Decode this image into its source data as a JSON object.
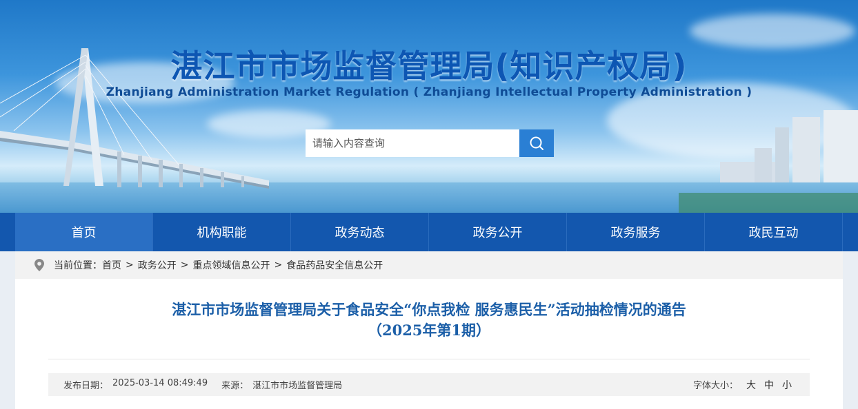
{
  "header": {
    "title": "湛江市市场监督管理局(知识产权局)",
    "subtitle": "Zhanjiang Administration Market Regulation ( Zhanjiang Intellectual Property Administration )"
  },
  "search": {
    "placeholder": "请输入内容查询",
    "icon": "search-icon"
  },
  "nav": {
    "items": [
      {
        "label": "首页"
      },
      {
        "label": "机构职能"
      },
      {
        "label": "政务动态"
      },
      {
        "label": "政务公开"
      },
      {
        "label": "政务服务"
      },
      {
        "label": "政民互动"
      }
    ],
    "active_index": 0
  },
  "breadcrumb": {
    "prefix": "当前位置：",
    "items": [
      "首页",
      "政务公开",
      "重点领域信息公开",
      "食品药品安全信息公开"
    ],
    "separator": ">"
  },
  "article": {
    "title_line1": "湛江市市场监督管理局关于食品安全“你点我检  服务惠民生”活动抽检情况的通告",
    "title_line2": "（2025年第1期）",
    "date_label": "发布日期：",
    "date_value": "2025-03-14 08:49:49",
    "source_label": "来源：",
    "source_value": "湛江市市场监督管理局",
    "font_size_label": "字体大小：",
    "font_size_options": [
      "大",
      "中",
      "小"
    ]
  },
  "colors": {
    "nav_bg": "#1357ae",
    "nav_active": "#2a6fc4",
    "title_blue": "#0d56b3",
    "article_title": "#1c5fa8",
    "search_button": "#2a7fd4"
  }
}
